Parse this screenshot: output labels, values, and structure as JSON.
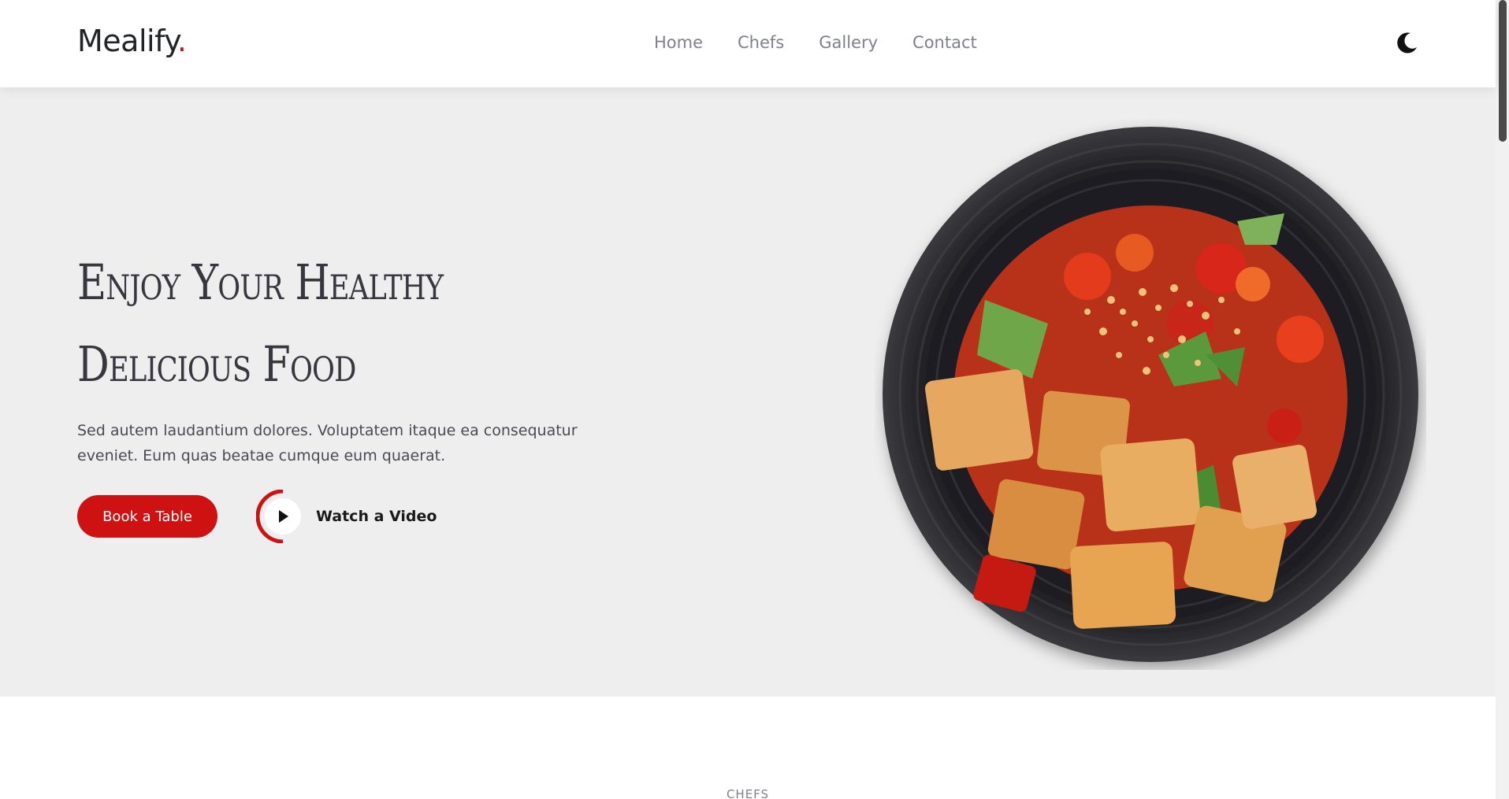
{
  "header": {
    "logo_text": "Mealify",
    "logo_dot": ".",
    "nav": [
      {
        "label": "Home"
      },
      {
        "label": "Chefs"
      },
      {
        "label": "Gallery"
      },
      {
        "label": "Contact"
      }
    ],
    "theme_toggle_icon": "moon-icon"
  },
  "hero": {
    "headline_line1": "Enjoy Your Healthy",
    "headline_line2": "Delicious Food",
    "description": "Sed autem laudantium dolores. Voluptatem itaque ea consequatur eveniet. Eum quas beatae cumque eum quaerat.",
    "book_button": "Book a Table",
    "video_button": "Watch a Video",
    "play_icon": "play-icon"
  },
  "next_section": {
    "label": "CHEFS"
  },
  "colors": {
    "accent": "#ce1212",
    "hero_bg": "#eeeeee",
    "nav_text": "#7f7f90"
  }
}
